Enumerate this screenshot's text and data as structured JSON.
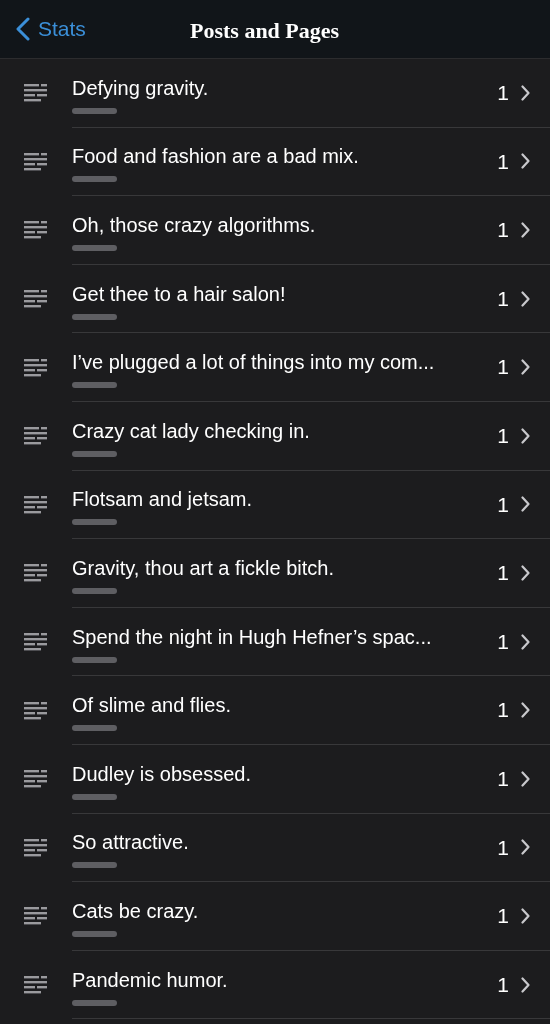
{
  "nav": {
    "back_label": "Stats",
    "title": "Posts and Pages"
  },
  "rows": [
    {
      "title": "Defying gravity.",
      "count": "1"
    },
    {
      "title": "Food and fashion are a bad mix.",
      "count": "1"
    },
    {
      "title": "Oh, those crazy algorithms.",
      "count": "1"
    },
    {
      "title": "Get thee to a hair salon!",
      "count": "1"
    },
    {
      "title": "I’ve plugged a lot of things into my com...",
      "count": "1"
    },
    {
      "title": "Crazy cat lady checking in.",
      "count": "1"
    },
    {
      "title": "Flotsam and jetsam.",
      "count": "1"
    },
    {
      "title": "Gravity, thou art a fickle bitch.",
      "count": "1"
    },
    {
      "title": "Spend the night in Hugh Hefner’s spac...",
      "count": "1"
    },
    {
      "title": "Of slime and flies.",
      "count": "1"
    },
    {
      "title": "Dudley is obsessed.",
      "count": "1"
    },
    {
      "title": "So attractive.",
      "count": "1"
    },
    {
      "title": "Cats be crazy.",
      "count": "1"
    },
    {
      "title": "Pandemic humor.",
      "count": "1"
    }
  ]
}
